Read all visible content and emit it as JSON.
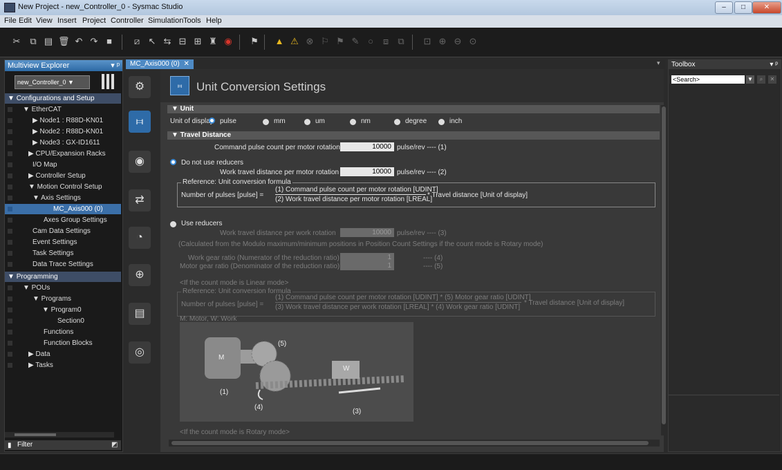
{
  "window": {
    "title": "New Project - new_Controller_0 - Sysmac Studio",
    "min": "–",
    "max": "□",
    "close": "✕"
  },
  "menu": [
    "File",
    "Edit",
    "View",
    "Insert",
    "Project",
    "Controller",
    "Simulation",
    "Tools",
    "Help"
  ],
  "explorer": {
    "title": "Multiview Explorer",
    "pin": "▾ ᵖ",
    "controller": "new_Controller_0 ▼",
    "items": [
      {
        "label": "Configurations and Setup",
        "type": "cat"
      },
      {
        "label": "▼ EtherCAT"
      },
      {
        "label": "▶ Node1 : R88D-KN01"
      },
      {
        "label": "▶ Node2 : R88D-KN01"
      },
      {
        "label": "▶ Node3 : GX-ID1611"
      },
      {
        "label": "▶ CPU/Expansion Racks"
      },
      {
        "label": "I/O Map"
      },
      {
        "label": "▶ Controller Setup"
      },
      {
        "label": "▼ Motion Control Setup"
      },
      {
        "label": "▼ Axis Settings"
      },
      {
        "label": "MC_Axis000 (0)",
        "type": "selected"
      },
      {
        "label": "Axes Group Settings"
      },
      {
        "label": "Cam Data Settings"
      },
      {
        "label": "Event Settings"
      },
      {
        "label": "Task Settings"
      },
      {
        "label": "Data Trace Settings"
      },
      {
        "label": "Programming",
        "type": "cat"
      },
      {
        "label": "▼ POUs"
      },
      {
        "label": "▼ Programs"
      },
      {
        "label": "▼ Program0"
      },
      {
        "label": "Section0"
      },
      {
        "label": "Functions"
      },
      {
        "label": "Function Blocks"
      },
      {
        "label": "▶ Data"
      },
      {
        "label": "▶ Tasks"
      }
    ],
    "filter": "Filter"
  },
  "tab": {
    "label": "MC_Axis000 (0)",
    "close": "✕"
  },
  "editor": {
    "title": "Unit Conversion Settings",
    "unit_section": "▼ Unit",
    "unit_of_display": "Unit of display",
    "units": [
      "pulse",
      "mm",
      "um",
      "nm",
      "degree",
      "inch"
    ],
    "travel_section": "▼ Travel Distance",
    "cmd_pulse_label": "Command pulse count per motor rotation",
    "cmd_pulse_value": "10000",
    "cmd_pulse_unit": "pulse/rev ---- (1)",
    "no_reducer": "Do not use reducers",
    "work_travel_label": "Work travel distance per motor rotation",
    "work_travel_value": "10000",
    "work_travel_unit": "pulse/rev ---- (2)",
    "reference1_title": "Reference: Unit conversion formula",
    "num_pulses": "Number of pulses [pulse] =",
    "formula1_num": "(1) Command pulse count per motor rotation [UDINT]",
    "formula1_den": "(2) Work travel distance per motor rotation [LREAL]",
    "formula1_tail": "* Travel distance [Unit of display]",
    "use_reducers": "Use reducers",
    "work_rot_label": "Work travel distance per work rotation",
    "work_rot_value": "10000",
    "work_rot_unit": "pulse/rev ---- (3)",
    "calc_note": "(Calculated from the Modulo maximum/minimum positions in Position Count Settings if the count mode is Rotary mode)",
    "gear_num_label": "Work gear ratio (Numerator of the reduction ratio)",
    "gear_num_value": "1",
    "gear_num_tag": "---- (4)",
    "gear_den_label": "Motor gear ratio (Denominator of the reduction ratio)",
    "gear_den_value": "1",
    "gear_den_tag": "---- (5)",
    "linear_mode": "<If the count mode is Linear mode>",
    "reference2_title": "Reference: Unit conversion formula",
    "formula2_num": "(1) Command pulse count per motor rotation [UDINT] * (5) Motor gear ratio [UDINT]",
    "formula2_den": "(3) Work travel distance per work rotation [LREAL] * (4) Work gear ratio [UDINT]",
    "formula2_tail": "* Travel distance [Unit of display]",
    "legend": "M: Motor, W: Work",
    "diagram_labels": {
      "m": "M",
      "w": "W",
      "l1": "(1)",
      "l3": "(3)",
      "l4": "(4)",
      "l5": "(5)"
    },
    "rotary_mode": "<If the count mode is Rotary mode>"
  },
  "toolbox": {
    "title": "Toolbox",
    "pin": "▾ ᵖ",
    "search": "<Search>"
  }
}
